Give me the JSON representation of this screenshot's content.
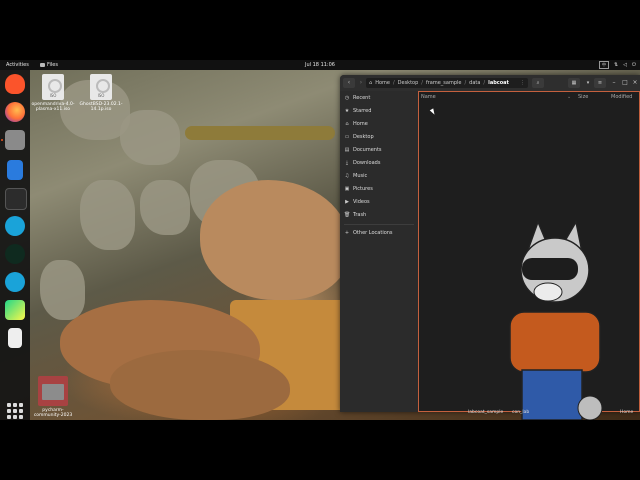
{
  "topbar": {
    "activities": "Activities",
    "app_name": "Files",
    "clock": "Jul 18  11:06",
    "keyboard_layout": "中",
    "tray_icons": [
      "keyboard-layout-icon",
      "network-icon",
      "volume-icon",
      "power-icon"
    ]
  },
  "dock": {
    "apps": [
      {
        "name": "brave-browser-icon",
        "color": "#fb542b"
      },
      {
        "name": "firefox-icon",
        "color": "#ff7139"
      },
      {
        "name": "files-icon",
        "color": "#8a8a8a"
      },
      {
        "name": "text-editor-icon",
        "color": "#2a7bde"
      },
      {
        "name": "terminal-icon",
        "color": "#2c2c2c"
      },
      {
        "name": "app-icon-1",
        "color": "#1aa3d9"
      },
      {
        "name": "mongodb-compass-icon",
        "color": "#13aa52"
      },
      {
        "name": "app-icon-2",
        "color": "#1aa3d9"
      },
      {
        "name": "pycharm-icon",
        "color": "#21d789"
      },
      {
        "name": "trash-icon",
        "color": "#6fbf5a"
      }
    ],
    "show_apps_label": "Show Applications"
  },
  "desktop": {
    "icons": [
      {
        "label": "openmandriva-4.0-plasma-x11.iso",
        "badge": "ISO"
      },
      {
        "label": "GhostBSD-23.02.1-14.1p.iso",
        "badge": "ISO"
      },
      {
        "label": "pycharm-community-2023",
        "badge": ""
      }
    ]
  },
  "files_window": {
    "path": [
      "Home",
      "Desktop",
      "frame_sample",
      "data",
      "labcoat"
    ],
    "columns": {
      "name": "Name",
      "size": "Size",
      "modified": "Modified"
    },
    "sidebar": [
      {
        "label": "Recent",
        "icon": "clock-icon"
      },
      {
        "label": "Starred",
        "icon": "star-icon"
      },
      {
        "label": "Home",
        "icon": "home-icon"
      },
      {
        "label": "Desktop",
        "icon": "desktop-icon"
      },
      {
        "label": "Documents",
        "icon": "documents-icon"
      },
      {
        "label": "Downloads",
        "icon": "downloads-icon"
      },
      {
        "label": "Music",
        "icon": "music-icon"
      },
      {
        "label": "Pictures",
        "icon": "pictures-icon"
      },
      {
        "label": "Videos",
        "icon": "videos-icon"
      },
      {
        "label": "Trash",
        "icon": "trash-icon"
      },
      {
        "label": "Other Locations",
        "icon": "plus-icon"
      }
    ]
  },
  "taskbar_hints": [
    "labcoat_sample",
    "con_lab",
    "Home"
  ]
}
